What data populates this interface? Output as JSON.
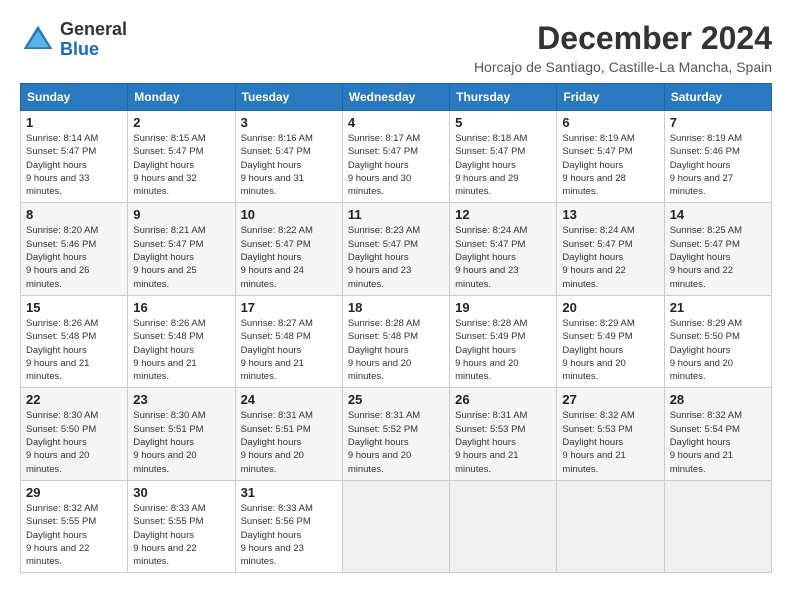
{
  "logo": {
    "line1": "General",
    "line2": "Blue"
  },
  "title": "December 2024",
  "location": "Horcajo de Santiago, Castille-La Mancha, Spain",
  "weekdays": [
    "Sunday",
    "Monday",
    "Tuesday",
    "Wednesday",
    "Thursday",
    "Friday",
    "Saturday"
  ],
  "weeks": [
    [
      {
        "day": "1",
        "sunrise": "8:14 AM",
        "sunset": "5:47 PM",
        "daylight": "9 hours and 33 minutes."
      },
      {
        "day": "2",
        "sunrise": "8:15 AM",
        "sunset": "5:47 PM",
        "daylight": "9 hours and 32 minutes."
      },
      {
        "day": "3",
        "sunrise": "8:16 AM",
        "sunset": "5:47 PM",
        "daylight": "9 hours and 31 minutes."
      },
      {
        "day": "4",
        "sunrise": "8:17 AM",
        "sunset": "5:47 PM",
        "daylight": "9 hours and 30 minutes."
      },
      {
        "day": "5",
        "sunrise": "8:18 AM",
        "sunset": "5:47 PM",
        "daylight": "9 hours and 29 minutes."
      },
      {
        "day": "6",
        "sunrise": "8:19 AM",
        "sunset": "5:47 PM",
        "daylight": "9 hours and 28 minutes."
      },
      {
        "day": "7",
        "sunrise": "8:19 AM",
        "sunset": "5:46 PM",
        "daylight": "9 hours and 27 minutes."
      }
    ],
    [
      {
        "day": "8",
        "sunrise": "8:20 AM",
        "sunset": "5:46 PM",
        "daylight": "9 hours and 26 minutes."
      },
      {
        "day": "9",
        "sunrise": "8:21 AM",
        "sunset": "5:47 PM",
        "daylight": "9 hours and 25 minutes."
      },
      {
        "day": "10",
        "sunrise": "8:22 AM",
        "sunset": "5:47 PM",
        "daylight": "9 hours and 24 minutes."
      },
      {
        "day": "11",
        "sunrise": "8:23 AM",
        "sunset": "5:47 PM",
        "daylight": "9 hours and 23 minutes."
      },
      {
        "day": "12",
        "sunrise": "8:24 AM",
        "sunset": "5:47 PM",
        "daylight": "9 hours and 23 minutes."
      },
      {
        "day": "13",
        "sunrise": "8:24 AM",
        "sunset": "5:47 PM",
        "daylight": "9 hours and 22 minutes."
      },
      {
        "day": "14",
        "sunrise": "8:25 AM",
        "sunset": "5:47 PM",
        "daylight": "9 hours and 22 minutes."
      }
    ],
    [
      {
        "day": "15",
        "sunrise": "8:26 AM",
        "sunset": "5:48 PM",
        "daylight": "9 hours and 21 minutes."
      },
      {
        "day": "16",
        "sunrise": "8:26 AM",
        "sunset": "5:48 PM",
        "daylight": "9 hours and 21 minutes."
      },
      {
        "day": "17",
        "sunrise": "8:27 AM",
        "sunset": "5:48 PM",
        "daylight": "9 hours and 21 minutes."
      },
      {
        "day": "18",
        "sunrise": "8:28 AM",
        "sunset": "5:48 PM",
        "daylight": "9 hours and 20 minutes."
      },
      {
        "day": "19",
        "sunrise": "8:28 AM",
        "sunset": "5:49 PM",
        "daylight": "9 hours and 20 minutes."
      },
      {
        "day": "20",
        "sunrise": "8:29 AM",
        "sunset": "5:49 PM",
        "daylight": "9 hours and 20 minutes."
      },
      {
        "day": "21",
        "sunrise": "8:29 AM",
        "sunset": "5:50 PM",
        "daylight": "9 hours and 20 minutes."
      }
    ],
    [
      {
        "day": "22",
        "sunrise": "8:30 AM",
        "sunset": "5:50 PM",
        "daylight": "9 hours and 20 minutes."
      },
      {
        "day": "23",
        "sunrise": "8:30 AM",
        "sunset": "5:51 PM",
        "daylight": "9 hours and 20 minutes."
      },
      {
        "day": "24",
        "sunrise": "8:31 AM",
        "sunset": "5:51 PM",
        "daylight": "9 hours and 20 minutes."
      },
      {
        "day": "25",
        "sunrise": "8:31 AM",
        "sunset": "5:52 PM",
        "daylight": "9 hours and 20 minutes."
      },
      {
        "day": "26",
        "sunrise": "8:31 AM",
        "sunset": "5:53 PM",
        "daylight": "9 hours and 21 minutes."
      },
      {
        "day": "27",
        "sunrise": "8:32 AM",
        "sunset": "5:53 PM",
        "daylight": "9 hours and 21 minutes."
      },
      {
        "day": "28",
        "sunrise": "8:32 AM",
        "sunset": "5:54 PM",
        "daylight": "9 hours and 21 minutes."
      }
    ],
    [
      {
        "day": "29",
        "sunrise": "8:32 AM",
        "sunset": "5:55 PM",
        "daylight": "9 hours and 22 minutes."
      },
      {
        "day": "30",
        "sunrise": "8:33 AM",
        "sunset": "5:55 PM",
        "daylight": "9 hours and 22 minutes."
      },
      {
        "day": "31",
        "sunrise": "8:33 AM",
        "sunset": "5:56 PM",
        "daylight": "9 hours and 23 minutes."
      },
      null,
      null,
      null,
      null
    ]
  ]
}
